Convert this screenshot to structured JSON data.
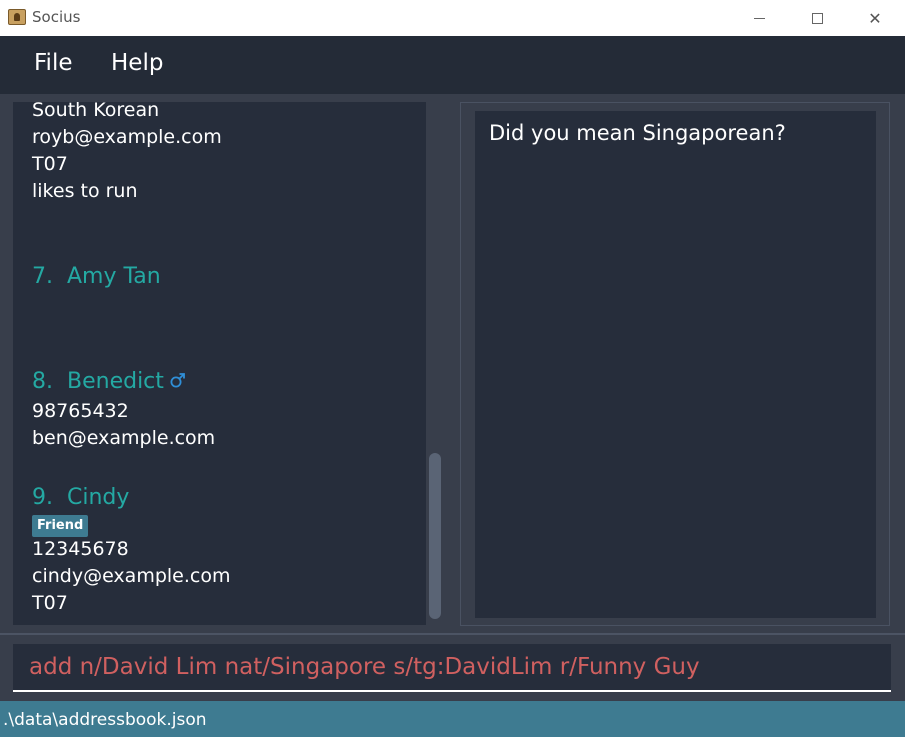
{
  "window": {
    "title": "Socius",
    "minimize_icon": "minimize-icon",
    "maximize_icon": "maximize-icon",
    "close_icon": "close-icon",
    "close_glyph": "✕"
  },
  "menu": {
    "file": "File",
    "help": "Help"
  },
  "contacts": {
    "partial": {
      "nationality": "South Korean",
      "email": "royb@example.com",
      "tutorial": "T07",
      "remark": "likes to run"
    },
    "items": [
      {
        "index": "7.",
        "name": "Amy Tan"
      },
      {
        "index": "8.",
        "name": "Benedict",
        "gender_icon": "male-gender-icon",
        "phone": "98765432",
        "email": "ben@example.com"
      },
      {
        "index": "9.",
        "name": "Cindy",
        "tag": "Friend",
        "phone": "12345678",
        "email": "cindy@example.com",
        "tutorial": "T07"
      }
    ]
  },
  "result": {
    "message": "Did you mean Singaporean?"
  },
  "command": {
    "value": "add n/David Lim nat/Singapore s/tg:DavidLim r/Funny Guy"
  },
  "status": {
    "path": ".\\data\\addressbook.json"
  },
  "colors": {
    "name_accent": "#24a9a3",
    "status_bar": "#3e7b91",
    "command_error": "#d06060"
  }
}
